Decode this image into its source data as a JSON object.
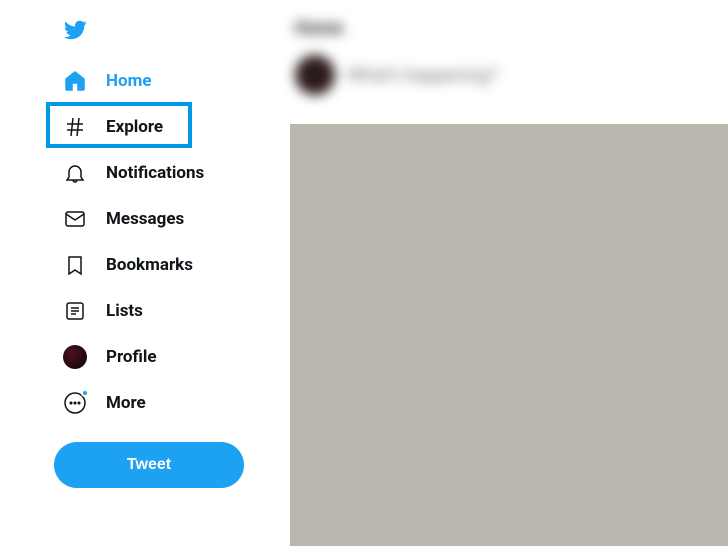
{
  "sidebar": {
    "items": [
      {
        "label": "Home"
      },
      {
        "label": "Explore"
      },
      {
        "label": "Notifications"
      },
      {
        "label": "Messages"
      },
      {
        "label": "Bookmarks"
      },
      {
        "label": "Lists"
      },
      {
        "label": "Profile"
      },
      {
        "label": "More"
      }
    ],
    "tweet_button": "Tweet"
  },
  "main": {
    "header_title": "Home",
    "compose_placeholder": "What's happening?"
  },
  "colors": {
    "brand": "#1DA1F2",
    "highlight": "#0099E5"
  }
}
